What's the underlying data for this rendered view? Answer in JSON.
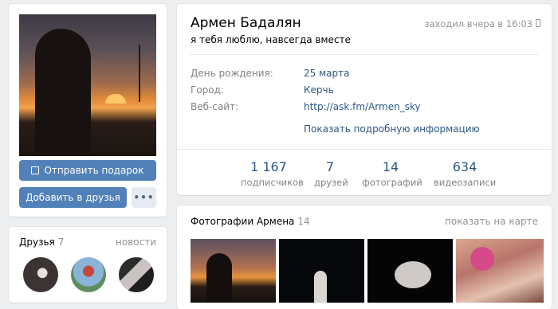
{
  "profile": {
    "name": "Армен Бадалян",
    "status": "я тебя люблю, навсегда вместе",
    "last_seen": "заходил вчера в 16:03",
    "info": [
      {
        "label": "День рождения:",
        "value": "25 марта"
      },
      {
        "label": "Город:",
        "value": "Керчь"
      },
      {
        "label": "Веб-сайт:",
        "value": "http://ask.fm/Armen_sky"
      }
    ],
    "show_more": "Показать подробную информацию",
    "counters": [
      {
        "value": "1 167",
        "label": "подписчиков"
      },
      {
        "value": "7",
        "label": "друзей"
      },
      {
        "value": "14",
        "label": "фотографий"
      },
      {
        "value": "634",
        "label": "видеозаписи"
      }
    ]
  },
  "actions": {
    "gift_label": "Отправить подарок",
    "add_friend_label": "Добавить в друзья",
    "more_label": "•••"
  },
  "friends": {
    "title": "Друзья",
    "count": "7",
    "news_link": "новости"
  },
  "photos": {
    "title": "Фотографии Армена",
    "count": "14",
    "map_link": "показать на карте"
  },
  "icons": {
    "gift": "gift-icon",
    "phone": "mobile-phone-icon",
    "more": "more-dots-icon"
  },
  "colors": {
    "link": "#2a5885",
    "button": "#5181b8",
    "background": "#edeef0",
    "muted": "#939393"
  }
}
